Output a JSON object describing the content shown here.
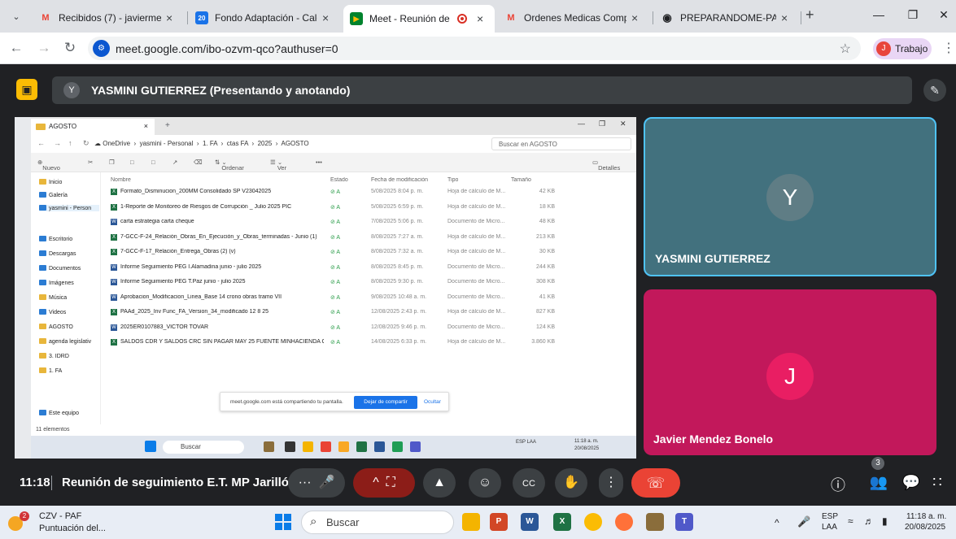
{
  "browser": {
    "tabs": [
      {
        "title": "Recibidos (7) - javiermendez",
        "favicon": "M"
      },
      {
        "title": "Fondo Adaptación - Calenda",
        "favicon": "20"
      },
      {
        "title": "Meet - Reunión de segu",
        "favicon": "▶"
      },
      {
        "title": "Ordenes Medicas Compens",
        "favicon": "M"
      },
      {
        "title": "PREPARANDOME-PARA-RES",
        "favicon": "◉"
      }
    ],
    "new_tab": "+",
    "url": "meet.google.com/ibo-ozvm-qco?authuser=0",
    "profile_label": "Trabajo",
    "profile_initial": "J"
  },
  "meet": {
    "presenter_initial": "Y",
    "presenter_label": "YASMINI GUTIERREZ (Presentando y anotando)",
    "participants": [
      {
        "initial": "Y",
        "name": "YASMINI GUTIERREZ"
      },
      {
        "initial": "J",
        "name": "Javier Mendez Bonelo"
      }
    ],
    "clock": "11:18",
    "meeting_title": "Reunión de seguimiento E.T. MP Jarilló...",
    "people_count": "3"
  },
  "explorer": {
    "tab_title": "AGOSTO",
    "breadcrumb": [
      "OneDrive",
      "yasmini - Personal",
      "1. FA",
      "ctas FA",
      "2025",
      "AGOSTO"
    ],
    "search_placeholder": "Buscar en AGOSTO",
    "toolbar": {
      "new": "Nuevo",
      "sort": "Ordenar",
      "view": "Ver",
      "more": "•••",
      "details": "Detalles"
    },
    "sidebar": [
      "Inicio",
      "Galería",
      "yasmini - Person",
      "Escritorio",
      "Descargas",
      "Documentos",
      "Imágenes",
      "Música",
      "Videos",
      "AGOSTO",
      "agenda legislativ",
      "3. IDRD",
      "1. FA",
      "Este equipo"
    ],
    "columns": [
      "Nombre",
      "Estado",
      "Fecha de modificación",
      "Tipo",
      "Tamaño"
    ],
    "rows": [
      {
        "name": "Formato_Disminucion_200MM Consolidado SP V23042025",
        "status": "⊘ A",
        "date": "5/08/2025 8:04 p. m.",
        "type": "Hoja de cálculo de M...",
        "size": "42 KB",
        "kind": "xls"
      },
      {
        "name": "1-Reporte de Monitoreo de Riesgos de Corrupción _ Julio 2025 PIC",
        "status": "⊘ A",
        "date": "5/08/2025 6:59 p. m.",
        "type": "Hoja de cálculo de M...",
        "size": "18 KB",
        "kind": "xls"
      },
      {
        "name": "carta estrategia carta cheque",
        "status": "⊘ A",
        "date": "7/08/2025 5:06 p. m.",
        "type": "Documento de Micro...",
        "size": "48 KB",
        "kind": "doc"
      },
      {
        "name": "7-GCC-F-24_Relación_Obras_En_Ejecución_y_Obras_terminadas - Junio (1)",
        "status": "⊘ A",
        "date": "8/08/2025 7:27 a. m.",
        "type": "Hoja de cálculo de M...",
        "size": "213 KB",
        "kind": "xls"
      },
      {
        "name": "7-GCC-F-17_Relación_Entrega_Obras (2) (v)",
        "status": "⊘ A",
        "date": "8/08/2025 7:32 a. m.",
        "type": "Hoja de cálculo de M...",
        "size": "30 KB",
        "kind": "xls"
      },
      {
        "name": "Informe Seguimiento PEG I.Alamadina junio - julio 2025",
        "status": "⊘ A",
        "date": "8/08/2025 8:45 p. m.",
        "type": "Documento de Micro...",
        "size": "244 KB",
        "kind": "doc"
      },
      {
        "name": "Informe Seguimiento PEG T.Paz junio - julio 2025",
        "status": "⊘ A",
        "date": "8/08/2025 9:30 p. m.",
        "type": "Documento de Micro...",
        "size": "308 KB",
        "kind": "doc"
      },
      {
        "name": "Aprobacion_Modificacion_Linea_Base 14 crono obras tramo VII",
        "status": "⊘ A",
        "date": "9/08/2025 10:48 a. m.",
        "type": "Documento de Micro...",
        "size": "41 KB",
        "kind": "doc"
      },
      {
        "name": "PAAd_2025_Inv Func_FA_Version_34_modificado 12 8 25",
        "status": "⊘ A",
        "date": "12/08/2025 2:43 p. m.",
        "type": "Hoja de cálculo de M...",
        "size": "827 KB",
        "kind": "xls"
      },
      {
        "name": "2025ER0107883_VICTOR TOVAR",
        "status": "⊘ A",
        "date": "12/08/2025 9:46 p. m.",
        "type": "Documento de Micro...",
        "size": "124 KB",
        "kind": "doc"
      },
      {
        "name": "SALDOS CDR Y SALDOS CRC SIN PAGAR MAY 25 FUENTE MINHACIENDA Cons...",
        "status": "⊘ A",
        "date": "14/08/2025 6:33 p. m.",
        "type": "Hoja de cálculo de M...",
        "size": "3.860 KB",
        "kind": "xls"
      }
    ],
    "status": "11 elementos",
    "share_text": "meet.google.com está compartiendo tu pantalla.",
    "share_stop": "Dejar de compartir",
    "share_hide": "Ocultar",
    "taskbar_search": "Buscar",
    "tray_lang": "ESP LAA",
    "tray_time": "11:18 a. m.",
    "tray_date": "20/08/2025"
  },
  "taskbar": {
    "weather_line1": "CZV - PAF",
    "weather_line2": "Puntuación del...",
    "weather_badge": "2",
    "search": "Buscar",
    "lang1": "ESP",
    "lang2": "LAA",
    "time": "11:18 a. m.",
    "date": "20/08/2025"
  },
  "colors": {
    "meet_bg": "#202124",
    "tile_teal": "#42717e",
    "tile_pink": "#c2185b",
    "hangup": "#ea4335",
    "accent": "#1a73e8"
  }
}
